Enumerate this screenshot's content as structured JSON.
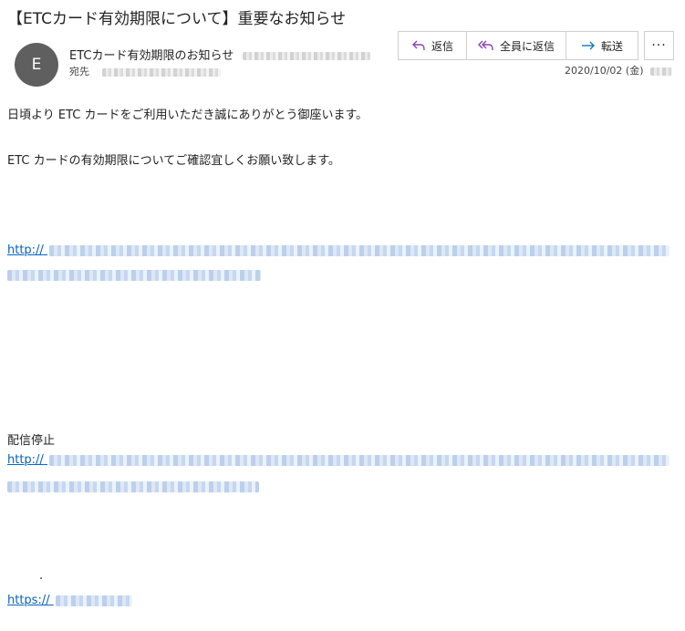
{
  "subject": "【ETCカード有効期限について】重要なお知らせ",
  "sender": {
    "avatar_letter": "E",
    "name": "ETCカード有効期限のお知らせ"
  },
  "to": {
    "label": "宛先"
  },
  "actions": {
    "reply": "返信",
    "reply_all": "全員に返信",
    "forward": "転送",
    "more": "···"
  },
  "date": "2020/10/02 (金)",
  "body": {
    "line1": "日頃より ETC カードをご利用いただき誠にありがとう御座います。",
    "line2": "ETC カードの有効期限についてご確認宜しくお願い致します。",
    "link1": "http://",
    "unsubscribe": "配信停止",
    "link2": "http://",
    "dot": ".",
    "link3": "https://"
  },
  "colors": {
    "link": "#0563c1",
    "avatar": "#5f5f5f",
    "reply_all_icon": "#8f3fb5",
    "forward_icon": "#1a73b5"
  }
}
